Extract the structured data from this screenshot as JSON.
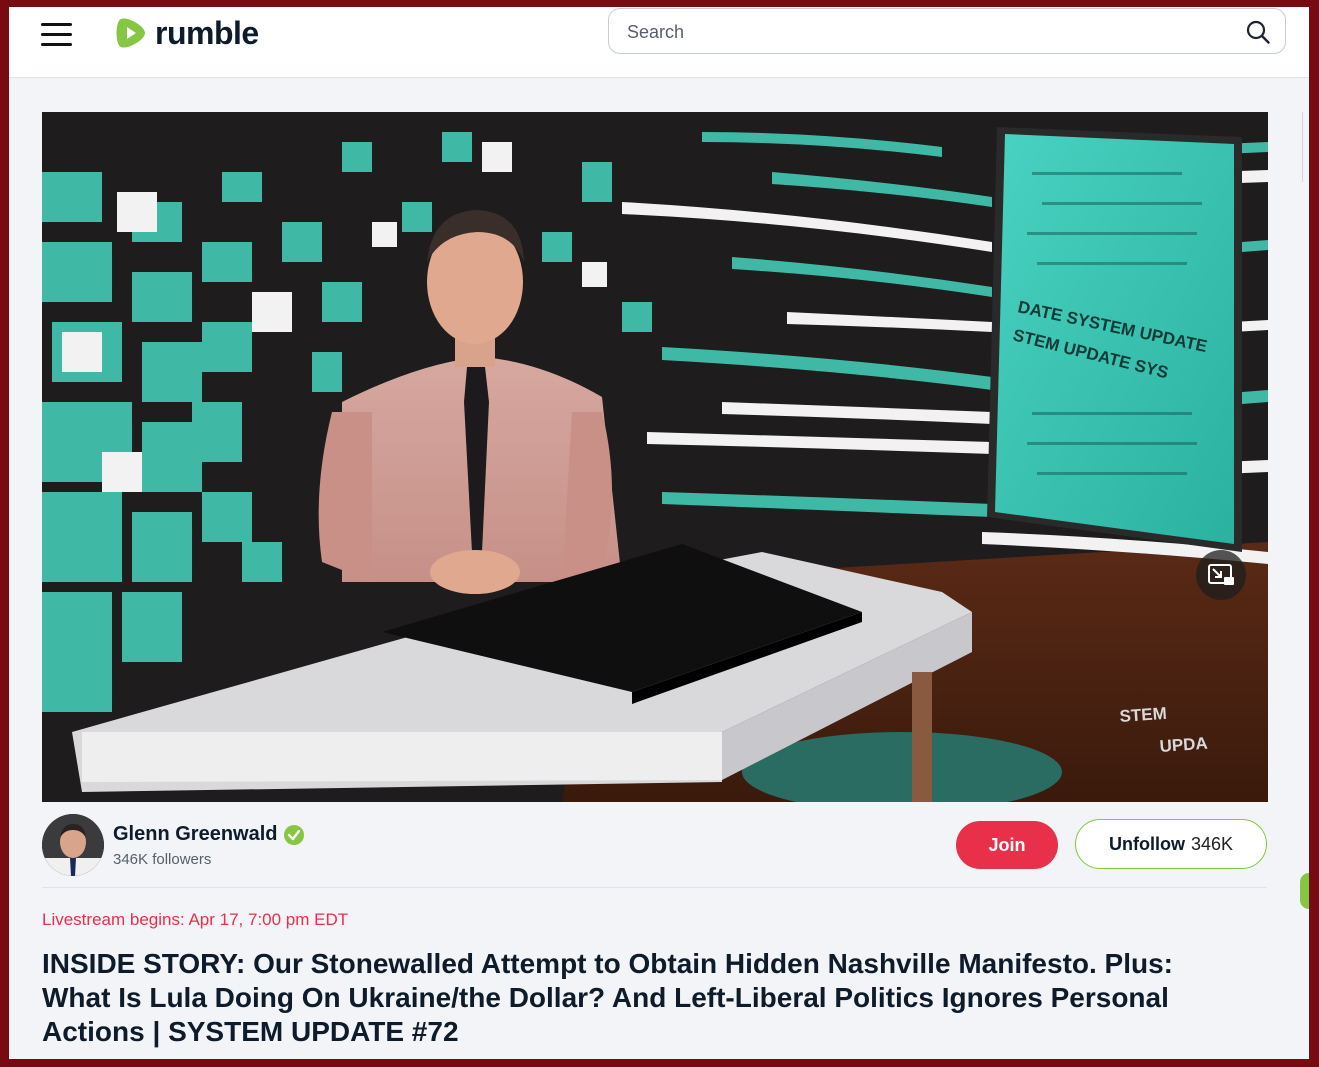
{
  "header": {
    "brand": "rumble",
    "search": {
      "placeholder": "Search",
      "value": ""
    }
  },
  "video": {
    "overlay_text": [
      "DATE SYSTEM UPDATE",
      "STEM UPDATE SYS",
      "STEM",
      "UPDA"
    ]
  },
  "channel": {
    "name": "Glenn Greenwald",
    "followers": "346K followers",
    "verified": true,
    "join_label": "Join",
    "unfollow_label": "Unfollow",
    "follower_count": "346K"
  },
  "stream": {
    "status": "Livestream begins: Apr 17, 7:00 pm EDT",
    "title": "INSIDE STORY: Our Stonewalled Attempt to Obtain Hidden Nashville Manifesto. Plus: What Is Lula Doing On Ukraine/the Dollar? And Left-Liberal Politics Ignores Personal Actions | SYSTEM UPDATE #72"
  },
  "colors": {
    "brand_green": "#85c742",
    "join_red": "#e8304a",
    "teal": "#3fb9a6",
    "frame": "#7a0a12"
  },
  "icons": [
    "menu-icon",
    "rumble-logo-icon",
    "search-icon",
    "picture-in-picture-icon",
    "verified-check-icon"
  ]
}
